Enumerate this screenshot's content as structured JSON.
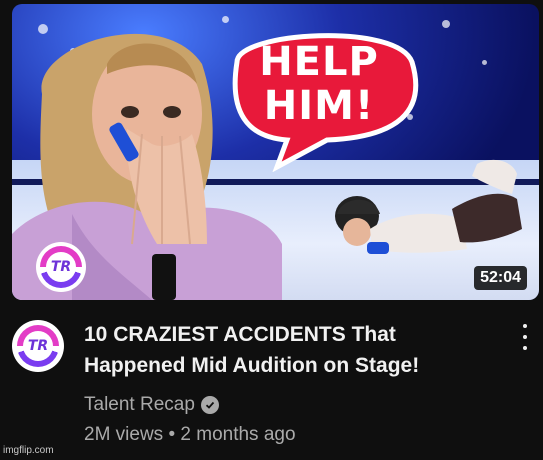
{
  "video": {
    "thumbnail": {
      "bubble_line1": "HELP",
      "bubble_line2": "HIM!",
      "logo_text": "TR",
      "duration": "52:04"
    },
    "channel_avatar_text": "TR",
    "title_line1": "10 CRAZIEST ACCIDENTS That",
    "title_line2": "Happened Mid Audition on Stage!",
    "channel_name": "Talent Recap",
    "verified_icon": "check-circle-icon",
    "views": "2M views",
    "separator": "•",
    "age": "2 months ago",
    "more_icon": "kebab-menu-icon"
  },
  "watermark": "imgflip.com",
  "colors": {
    "background": "#0f0f0f",
    "title": "#f1f1f1",
    "meta": "#aaaaaa",
    "bubble": "#e8193a",
    "logo_pink": "#e33cc6",
    "logo_purple": "#7a3cf0"
  }
}
